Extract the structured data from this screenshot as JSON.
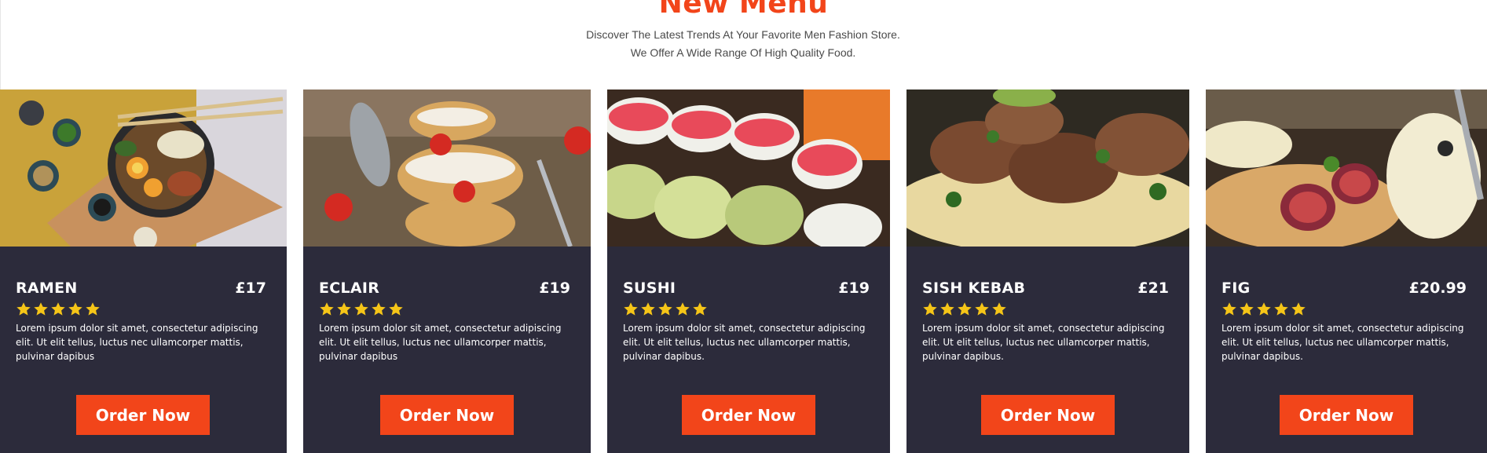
{
  "header": {
    "title": "New Menu",
    "subtitle": "Discover The Latest Trends At Your Favorite Men Fashion Store. We Offer A Wide Range Of High Quality Food."
  },
  "colors": {
    "accent": "#f2451a",
    "card_bg": "#2c2b3b",
    "star": "#f5c518"
  },
  "cards": [
    {
      "name": "RAMEN",
      "price": "£17",
      "rating": 5,
      "image": "ramen-bowl-image",
      "description": "Lorem ipsum dolor sit amet, consectetur adipiscing elit. Ut elit tellus, luctus nec ullamcorper mattis, pulvinar dapibus",
      "button": "Order Now"
    },
    {
      "name": "ECLAIR",
      "price": "£19",
      "rating": 5,
      "image": "eclair-strawberry-image",
      "description": "Lorem ipsum dolor sit amet, consectetur adipiscing elit. Ut elit tellus, luctus nec ullamcorper mattis, pulvinar dapibus",
      "button": "Order Now"
    },
    {
      "name": "SUSHI",
      "price": "£19",
      "rating": 5,
      "image": "sushi-rolls-image",
      "description": "Lorem ipsum dolor sit amet, consectetur adipiscing elit. Ut elit tellus, luctus nec ullamcorper mattis, pulvinar dapibus.",
      "button": "Order Now"
    },
    {
      "name": "SISH KEBAB",
      "price": "£21",
      "rating": 5,
      "image": "kebab-meat-image",
      "description": "Lorem ipsum dolor sit amet, consectetur adipiscing elit. Ut elit tellus, luctus nec ullamcorper mattis, pulvinar dapibus.",
      "button": "Order Now"
    },
    {
      "name": "FIG",
      "price": "£20.99",
      "rating": 5,
      "image": "fig-cheese-toast-image",
      "description": "Lorem ipsum dolor sit amet, consectetur adipiscing elit. Ut elit tellus, luctus nec ullamcorper mattis, pulvinar dapibus.",
      "button": "Order Now"
    }
  ]
}
